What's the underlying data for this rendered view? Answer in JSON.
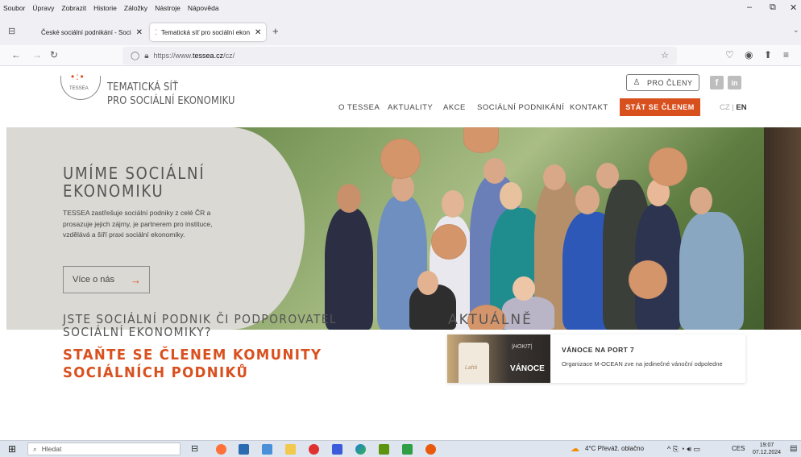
{
  "menubar": {
    "items": [
      "Soubor",
      "Úpravy",
      "Zobrazit",
      "Historie",
      "Záložky",
      "Nástroje",
      "Nápověda"
    ]
  },
  "tabs": [
    {
      "label": "České sociální podnikání - Soci",
      "active": false
    },
    {
      "label": "Tematická síť pro sociální ekon",
      "active": true
    }
  ],
  "new_tab_label": "+",
  "address": {
    "prefix": "https://www.",
    "domain": "tessea.cz",
    "path": "/cz/"
  },
  "site": {
    "logo_small": "TESSEA",
    "logo_line1": "TEMATICKÁ SÍŤ",
    "logo_line2": "PRO SOCIÁLNÍ EKONOMIKU",
    "members_button": "PRO ČLENY",
    "social": [
      "f",
      "in"
    ],
    "nav": [
      "O TESSEA",
      "AKTUALITY",
      "AKCE",
      "SOCIÁLNÍ PODNIKÁNÍ",
      "KONTAKT"
    ],
    "join_button": "STÁT SE ČLENEM",
    "lang_cz": "CZ",
    "lang_sep": " | ",
    "lang_en": "EN"
  },
  "hero": {
    "title_line1": "UMÍME SOCIÁLNÍ",
    "title_line2": "EKONOMIKU",
    "description": "TESSEA zastřešuje sociální podniky z celé ČR a prosazuje jejich zájmy, je partnerem pro instituce, vzdělává a šíří praxi sociální ekonomiky.",
    "button": "Více o nás",
    "button_arrow": "→"
  },
  "membership": {
    "question_line1": "JSTE SOCIÁLNÍ PODNIK ČI PODPOROVATEL",
    "question_line2": "SOCIÁLNÍ EKONOMIKY?",
    "cta_line1": "STAŇTE SE ČLENEM KOMUNITY",
    "cta_line2": "SOCIÁLNÍCH PODNIKŮ"
  },
  "news": {
    "heading": "AKTUÁLNĚ",
    "items": [
      {
        "title": "VÁNOCE NA PORT 7",
        "text": "Organizace M-OCEAN zve na jedinečné vánoční odpoledne",
        "img_text1": "|HOKIT|",
        "img_text2": "VÁNOCE",
        "img_text3": "Lahti"
      }
    ]
  },
  "taskbar": {
    "search_placeholder": "Hledat",
    "weather": "4°C  Převáž. oblačno",
    "lang": "CES",
    "time": "19:07",
    "date": "07.12.2024"
  },
  "colors": {
    "accent": "#d9501f",
    "hero_panel": "#dad9d3"
  }
}
